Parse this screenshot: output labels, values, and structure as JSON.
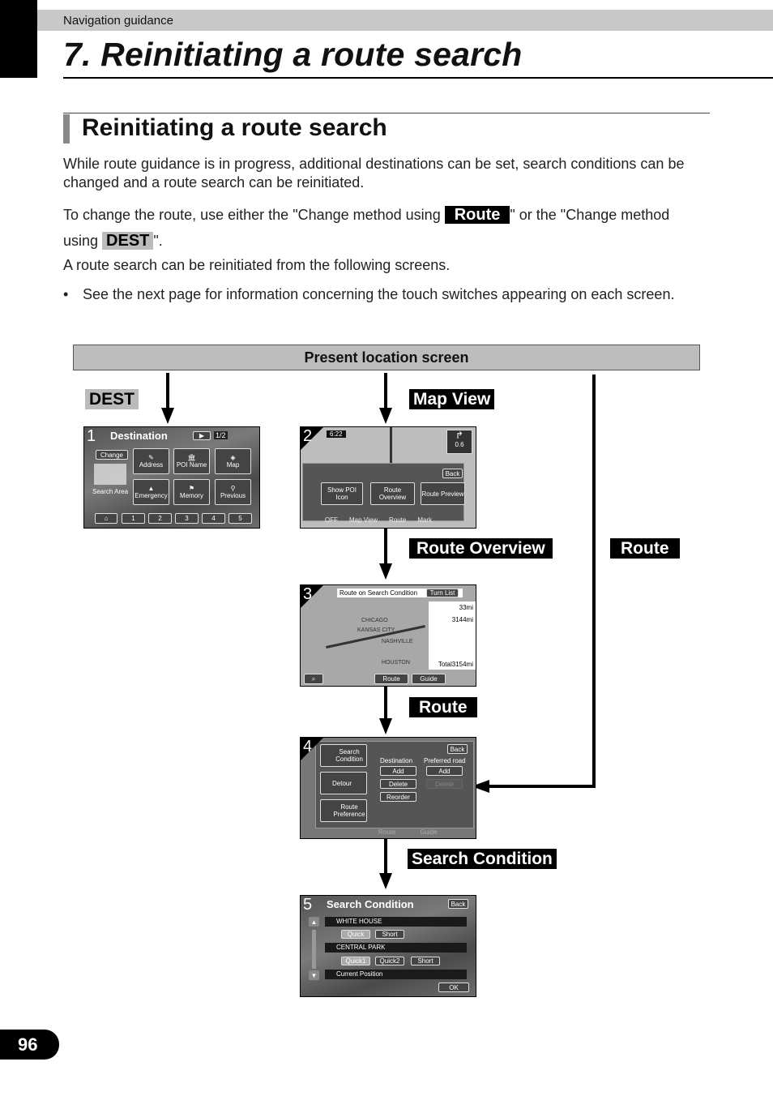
{
  "header": {
    "section": "Navigation guidance",
    "title": "7. Reinitiating a route search",
    "page_number": "96"
  },
  "section": {
    "heading": "Reinitiating a route search",
    "para1": "While route guidance is in progress, additional destinations can be set, search conditions can be changed and a route search can be reinitiated.",
    "para2_a": "To change the route, use either the \"Change method using ",
    "para2_route": "Route",
    "para2_b": "\" or the \"Change method",
    "para2_c": "using ",
    "para2_dest": "DEST",
    "para2_d": "\".",
    "para3": "A route search can be reinitiated from the following screens.",
    "bullet": "See the next page for information concerning the touch switches appearing on each screen."
  },
  "diagram": {
    "present": "Present location screen",
    "labels": {
      "dest": "DEST",
      "map_view": "Map View",
      "route_overview": "Route Overview",
      "route_right": "Route",
      "route": "Route",
      "search_condition": "Search Condition"
    }
  },
  "screens": {
    "s1": {
      "num": "1",
      "title": "Destination",
      "page": "1/2",
      "change": "Change",
      "search_area": "Search Area",
      "buttons": [
        "Address",
        "POI Name",
        "Map",
        "Emergency",
        "Memory",
        "Previous"
      ],
      "presets": [
        "1",
        "2",
        "3",
        "4",
        "5"
      ]
    },
    "s2": {
      "num": "2",
      "time": "6:22",
      "dist": "0.6",
      "back": "Back",
      "buttons": [
        "Show POI Icon",
        "Route Overview",
        "Route Preview"
      ],
      "bottom": [
        "OFF",
        "Map View",
        "Route",
        "Mark"
      ]
    },
    "s3": {
      "num": "3",
      "title": "Route on Search Condition",
      "turn_list": "Turn List",
      "d1": "33mi",
      "d2": "3144mi",
      "total": "Total3154mi",
      "route": "Route",
      "guide": "Guide",
      "cities": [
        "CHICAGO",
        "KANSAS CITY",
        "NASHVILLE",
        "HOUSTON"
      ]
    },
    "s4": {
      "num": "4",
      "left": [
        "Search Condition",
        "Detour",
        "Route Preference"
      ],
      "back": "Back",
      "dest_hdr": "Destination",
      "pref_hdr": "Preferred road",
      "dest_btns": [
        "Add",
        "Delete",
        "Reorder"
      ],
      "pref_btns": [
        "Add",
        "Delete"
      ],
      "bottom": [
        "Route",
        "Guide"
      ]
    },
    "s5": {
      "num": "5",
      "title": "Search Condition",
      "back": "Back",
      "rows": [
        "WHITE HOUSE",
        "CENTRAL PARK",
        "Current Position"
      ],
      "opts1": [
        "Quick",
        "Short"
      ],
      "opts2": [
        "Quick1",
        "Quick2",
        "Short"
      ],
      "ok": "OK"
    }
  }
}
